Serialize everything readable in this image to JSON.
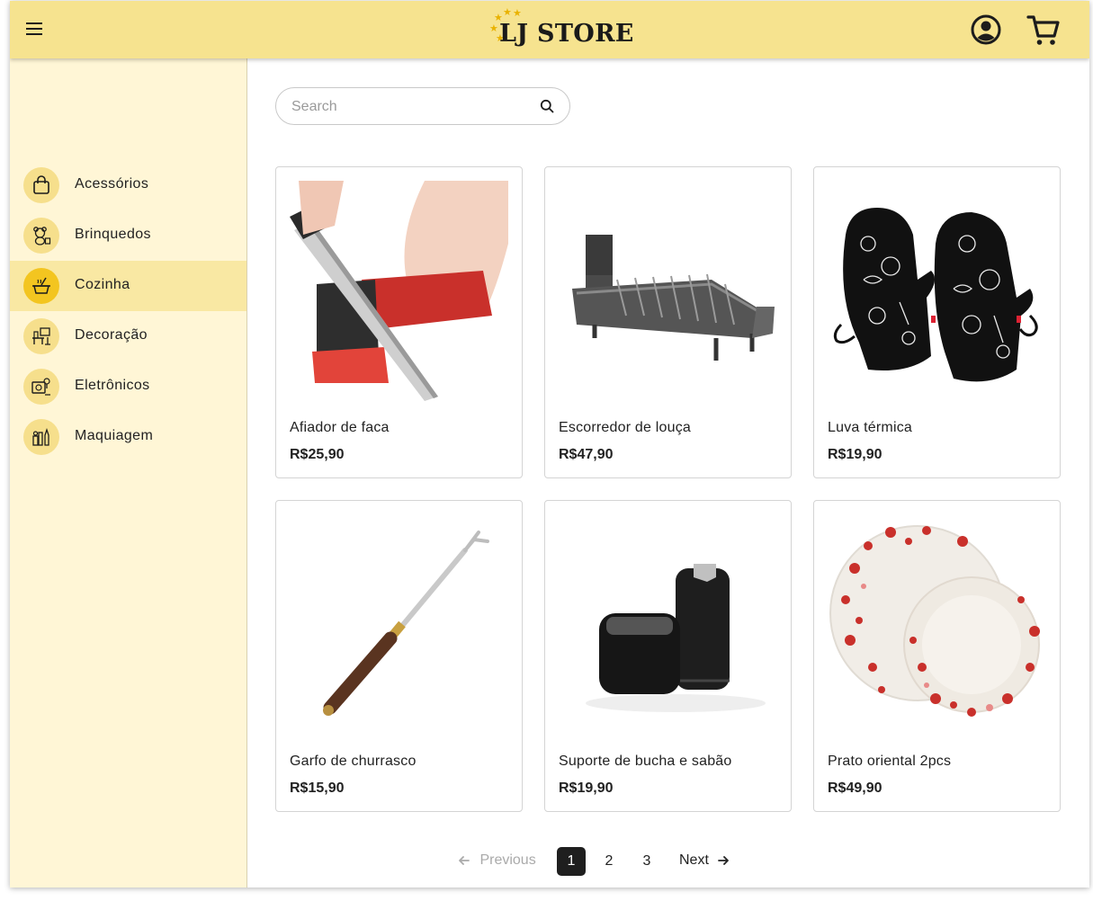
{
  "header": {
    "logo_text": "LJ STORE",
    "menu_icon": "hamburger-menu-icon",
    "account_icon": "account-circle-icon",
    "cart_icon": "shopping-cart-icon"
  },
  "sidebar": {
    "items": [
      {
        "label": "Acessórios",
        "icon": "shopping-bag-icon"
      },
      {
        "label": "Brinquedos",
        "icon": "teddy-bear-icon"
      },
      {
        "label": "Cozinha",
        "icon": "cooking-pot-icon",
        "active": true
      },
      {
        "label": "Decoração",
        "icon": "furniture-icon"
      },
      {
        "label": "Eletrônicos",
        "icon": "electronics-icon"
      },
      {
        "label": "Maquiagem",
        "icon": "makeup-icon"
      }
    ]
  },
  "search": {
    "placeholder": "Search",
    "value": ""
  },
  "products": [
    {
      "name": "Afiador de faca",
      "price": "R$25,90"
    },
    {
      "name": "Escorredor de louça",
      "price": "R$47,90"
    },
    {
      "name": "Luva térmica",
      "price": "R$19,90"
    },
    {
      "name": "Garfo de churrasco",
      "price": "R$15,90"
    },
    {
      "name": "Suporte de bucha e sabão",
      "price": "R$19,90"
    },
    {
      "name": "Prato oriental 2pcs",
      "price": "R$49,90"
    }
  ],
  "pagination": {
    "previous_label": "Previous",
    "next_label": "Next",
    "pages": [
      "1",
      "2",
      "3"
    ],
    "current_page": "1"
  },
  "colors": {
    "header_bg": "#f6e38f",
    "sidebar_bg": "#fff6d6",
    "active_item_bg": "#f9e8a3",
    "icon_circle": "#f6df8c",
    "active_icon_circle": "#f3c520"
  }
}
